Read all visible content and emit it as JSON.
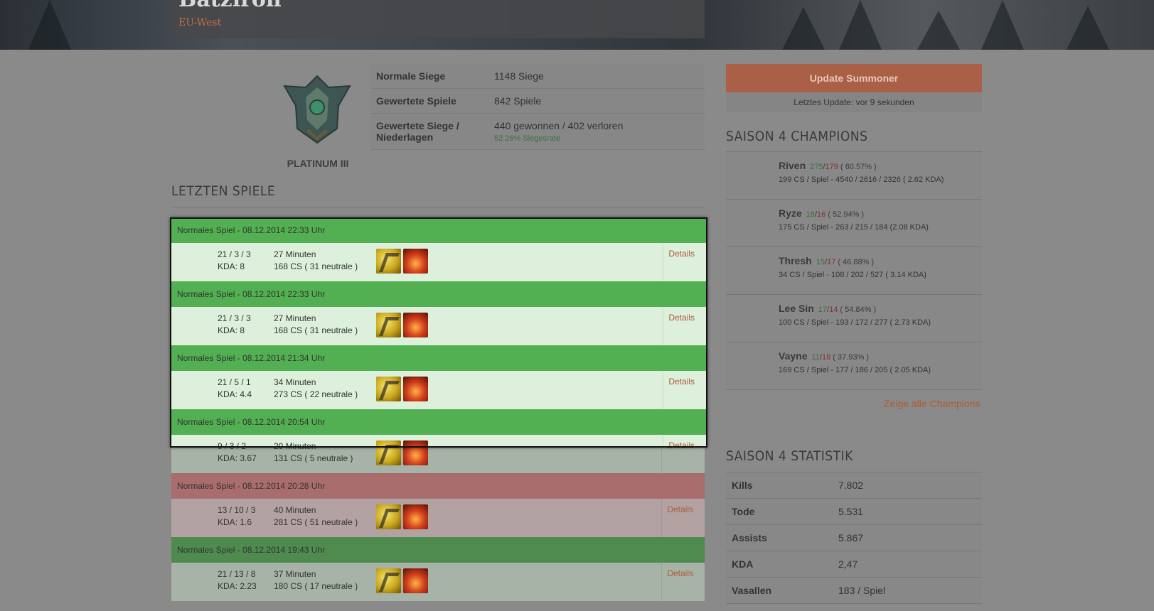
{
  "header": {
    "summoner_name": "Batzlron",
    "region": "EU-West"
  },
  "rank": {
    "label": "PLATINUM III"
  },
  "stats": [
    {
      "label": "Normale Siege",
      "value": "1148 Siege",
      "sub": ""
    },
    {
      "label": "Gewertete Spiele",
      "value": "842 Spiele",
      "sub": ""
    },
    {
      "label": "Gewertete Siege / Niederlagen",
      "value": "440 gewonnen / 402 verloren",
      "sub": "52.26% Siegesrate"
    }
  ],
  "recent_title": "LETZTEN SPIELE",
  "games": [
    {
      "result": "win",
      "header": "Normales Spiel - 08.12.2014 22:33 Uhr",
      "kda_line": "21 / 3 / 3",
      "kda": "KDA: 8",
      "duration": "27 Minuten",
      "cs": "168 CS ( 31 neutrale )",
      "details": "Details"
    },
    {
      "result": "win",
      "header": "Normales Spiel - 08.12.2014 22:33 Uhr",
      "kda_line": "21 / 3 / 3",
      "kda": "KDA: 8",
      "duration": "27 Minuten",
      "cs": "168 CS ( 31 neutrale )",
      "details": "Details"
    },
    {
      "result": "win",
      "header": "Normales Spiel - 08.12.2014 21:34 Uhr",
      "kda_line": "21 / 5 / 1",
      "kda": "KDA: 4.4",
      "duration": "34 Minuten",
      "cs": "273 CS ( 22 neutrale )",
      "details": "Details"
    },
    {
      "result": "win",
      "header": "Normales Spiel - 08.12.2014 20:54 Uhr",
      "kda_line": "9 / 3 / 2",
      "kda": "KDA: 3.67",
      "duration": "20 Minuten",
      "cs": "131 CS ( 5 neutrale )",
      "details": "Details"
    },
    {
      "result": "loss",
      "header": "Normales Spiel - 08.12.2014 20:28 Uhr",
      "kda_line": "13 / 10 / 3",
      "kda": "KDA: 1.6",
      "duration": "40 Minuten",
      "cs": "281 CS ( 51 neutrale )",
      "details": "Details"
    },
    {
      "result": "win",
      "header": "Normales Spiel - 08.12.2014 19:43 Uhr",
      "kda_line": "21 / 13 / 8",
      "kda": "KDA: 2.23",
      "duration": "37 Minuten",
      "cs": "180 CS ( 17 neutrale )",
      "details": "Details"
    }
  ],
  "update": {
    "button": "Update Summoner",
    "note": "Letztes Update: vor 9 sekunden"
  },
  "champions_title": "SAISON 4 CHAMPIONS",
  "champions": [
    {
      "name": "Riven",
      "wins": "275",
      "losses": "179",
      "rate": "( 60.57% )",
      "line2": "199 CS / Spiel - 4540 / 2616 / 2326 ( 2.62 KDA)"
    },
    {
      "name": "Ryze",
      "wins": "18",
      "losses": "16",
      "rate": "( 52.94% )",
      "line2": "175 CS / Spiel - 263 / 215 / 184 (2.08 KDA)"
    },
    {
      "name": "Thresh",
      "wins": "15",
      "losses": "17",
      "rate": "( 46.88% )",
      "line2": "34 CS / Spiel - 108 / 202 / 527 ( 3.14 KDA)"
    },
    {
      "name": "Lee Sin",
      "wins": "17",
      "losses": "14",
      "rate": "( 54.84% )",
      "line2": "100 CS / Spiel - 193 / 172 / 277 ( 2.73 KDA)"
    },
    {
      "name": "Vayne",
      "wins": "11",
      "losses": "18",
      "rate": "( 37.93% )",
      "line2": "169 CS / Spiel - 177 / 186 / 205 ( 2.05 KDA)"
    }
  ],
  "all_champions_link": "Zeige alle Champions",
  "season_stats_title": "SAISON 4 STATISTIK",
  "season_stats": [
    {
      "label": "Kills",
      "value": "7.802"
    },
    {
      "label": "Tode",
      "value": "5.531"
    },
    {
      "label": "Assists",
      "value": "5.867"
    },
    {
      "label": "KDA",
      "value": "2,47"
    },
    {
      "label": "Vasallen",
      "value": "183 / Spiel"
    }
  ],
  "icons": {
    "spell_1": "flash-icon",
    "spell_2": "ignite-icon",
    "rank_emblem": "platinum-emblem-icon"
  },
  "colors": {
    "accent": "#c96d45",
    "win": "#52b052",
    "loss": "#a96d6d"
  }
}
